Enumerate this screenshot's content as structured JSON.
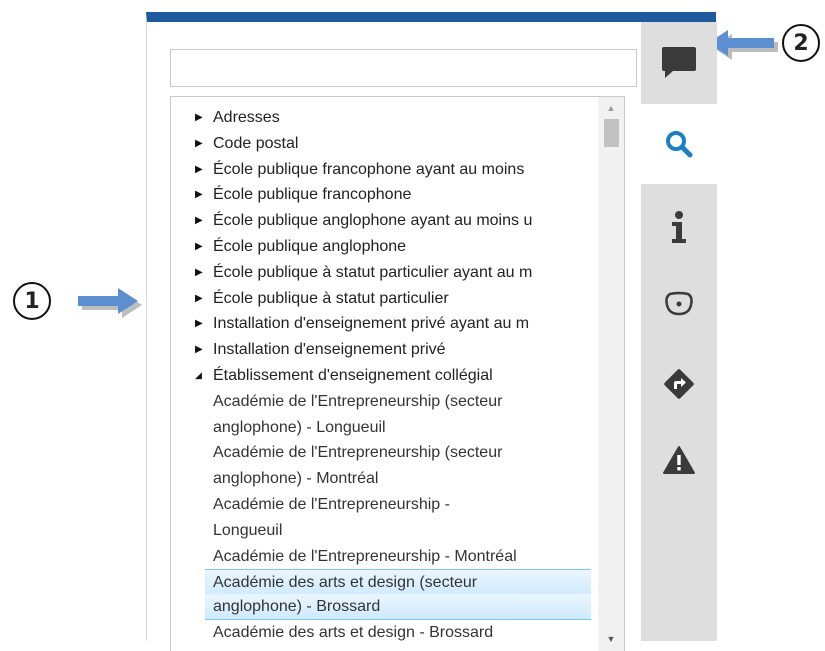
{
  "callouts": {
    "one": "1",
    "two": "2"
  },
  "search": {
    "value": "",
    "placeholder": ""
  },
  "tree": {
    "items": [
      {
        "label": "Adresses"
      },
      {
        "label": "Code postal"
      },
      {
        "label": "École publique francophone ayant au moins"
      },
      {
        "label": "École publique francophone"
      },
      {
        "label": "École publique anglophone ayant au moins u"
      },
      {
        "label": "École publique anglophone"
      },
      {
        "label": "École publique à statut particulier ayant au m"
      },
      {
        "label": "École publique à statut particulier"
      },
      {
        "label": "Installation d'enseignement privé ayant au m"
      },
      {
        "label": "Installation d'enseignement privé"
      }
    ],
    "expanded": {
      "label": "Établissement d'enseignement collégial",
      "children_lines": [
        "Académie de l'Entrepreneurship (secteur",
        "anglophone) - Longueuil",
        "Académie de l'Entrepreneurship (secteur",
        "anglophone) - Montréal",
        "Académie de l'Entrepreneurship -",
        "Longueuil",
        "Académie de l'Entrepreneurship - Montréal",
        "Académie des arts et design (secteur",
        "anglophone) - Brossard",
        "Académie des arts et design - Brossard"
      ]
    }
  },
  "toolbar": {
    "items": [
      {
        "icon": "chat-bubble-icon"
      },
      {
        "icon": "search-icon",
        "active": true
      },
      {
        "icon": "info-icon"
      },
      {
        "icon": "map-shape-icon"
      },
      {
        "icon": "directions-icon"
      },
      {
        "icon": "warning-icon"
      }
    ]
  },
  "colors": {
    "header_bar": "#1d5a9e",
    "accent": "#1a7fc4",
    "toolbar_bg": "#dedede",
    "callout_arrow": "#5b8fd1"
  }
}
